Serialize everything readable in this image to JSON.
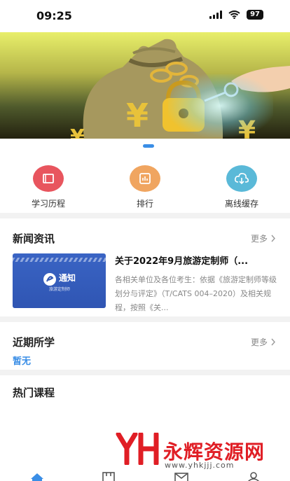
{
  "status_bar": {
    "time": "09:25",
    "battery": "97"
  },
  "banner": {
    "page_indicator_active": 1
  },
  "quick_nav": [
    {
      "label": "学习历程",
      "icon": "book-icon",
      "color": "#e8555e"
    },
    {
      "label": "排行",
      "icon": "chart-icon",
      "color": "#f0a560"
    },
    {
      "label": "离线缓存",
      "icon": "cloud-download-icon",
      "color": "#5ab9d8"
    }
  ],
  "news": {
    "title": "新闻资讯",
    "more": "更多",
    "item": {
      "thumb_title": "通知",
      "thumb_sub": "旅游定制师",
      "title": "关于2022年9月旅游定制师（...",
      "summary": "各相关单位及各位考生：依据《旅游定制师等级划分与评定》（T/CATS 004–2020）及相关规程，按照《关..."
    }
  },
  "recent": {
    "title": "近期所学",
    "more": "更多",
    "empty": "暂无"
  },
  "hot": {
    "title": "热门课程"
  },
  "watermark": {
    "logo": "YH",
    "name": "永辉资源网",
    "url": "www.yhkjjj.com"
  },
  "colors": {
    "accent": "#3a8ee6"
  }
}
